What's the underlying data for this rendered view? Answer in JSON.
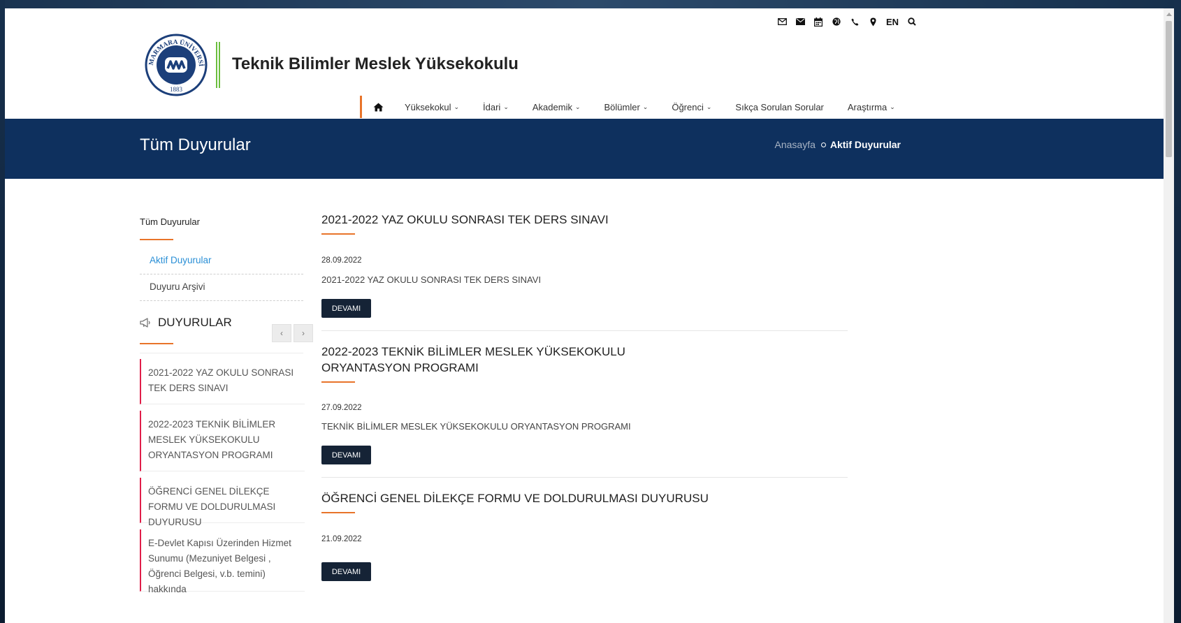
{
  "site": {
    "logo_text": "MARMARA ÜNİVERSİTESİ",
    "logo_year": "1883",
    "title": "Teknik Bilimler Meslek Yüksekokulu"
  },
  "topbar": {
    "icons": [
      "mail-outline-icon",
      "mail-solid-icon",
      "calendar-icon",
      "globe-icon",
      "phone-icon",
      "map-marker-icon",
      "search-icon"
    ],
    "lang": "EN"
  },
  "nav": {
    "items": [
      {
        "label": "Yüksekokul",
        "chevron": "⌄"
      },
      {
        "label": "İdari",
        "chevron": "⌄"
      },
      {
        "label": "Akademik",
        "chevron": "⌄"
      },
      {
        "label": "Bölümler",
        "chevron": "⌄"
      },
      {
        "label": "Öğrenci",
        "chevron": "⌄"
      },
      {
        "label": "Sıkça Sorulan Sorular",
        "chevron": ""
      },
      {
        "label": "Araştırma",
        "chevron": "⌄"
      }
    ]
  },
  "band": {
    "title": "Tüm Duyurular",
    "breadcrumb_home": "Anasayfa",
    "breadcrumb_current": "Aktif Duyurular"
  },
  "sidebar": {
    "heading": "Tüm Duyurular",
    "links": [
      "Aktif Duyurular",
      "Duyuru Arşivi"
    ],
    "duyuru_heading": "DUYURULAR",
    "prev": "‹",
    "next": "›",
    "cards": [
      "2021-2022 YAZ OKULU SONRASI TEK DERS SINAVI",
      "2022-2023 TEKNİK BİLİMLER MESLEK YÜKSEKOKULU ORYANTASYON PROGRAMI",
      "ÖĞRENCİ GENEL DİLEKÇE FORMU VE DOLDURULMASI DUYURUSU",
      "E-Devlet Kapısı Üzerinden Hizmet Sunumu (Mezuniyet Belgesi , Öğrenci Belgesi, v.b. temini) hakkında"
    ]
  },
  "posts": [
    {
      "title": "2021-2022 YAZ OKULU SONRASI TEK DERS SINAVI",
      "date": "28.09.2022",
      "summary": "2021-2022 YAZ OKULU SONRASI TEK DERS SINAVI",
      "button": "DEVAMI"
    },
    {
      "title": "2022-2023 TEKNİK BİLİMLER MESLEK YÜKSEKOKULU ORYANTASYON PROGRAMI",
      "date": "27.09.2022",
      "summary": "TEKNİK BİLİMLER MESLEK YÜKSEKOKULU ORYANTASYON PROGRAMI",
      "button": "DEVAMI"
    },
    {
      "title": "ÖĞRENCİ GENEL DİLEKÇE FORMU VE DOLDURULMASI DUYURUSU",
      "date": "21.09.2022",
      "summary": "",
      "button": "DEVAMI"
    }
  ],
  "colors": {
    "band": "#0e305e",
    "accent_orange": "#e8742a",
    "card_border": "#e01e49",
    "active_link": "#2a8fd6",
    "button": "#152336"
  }
}
